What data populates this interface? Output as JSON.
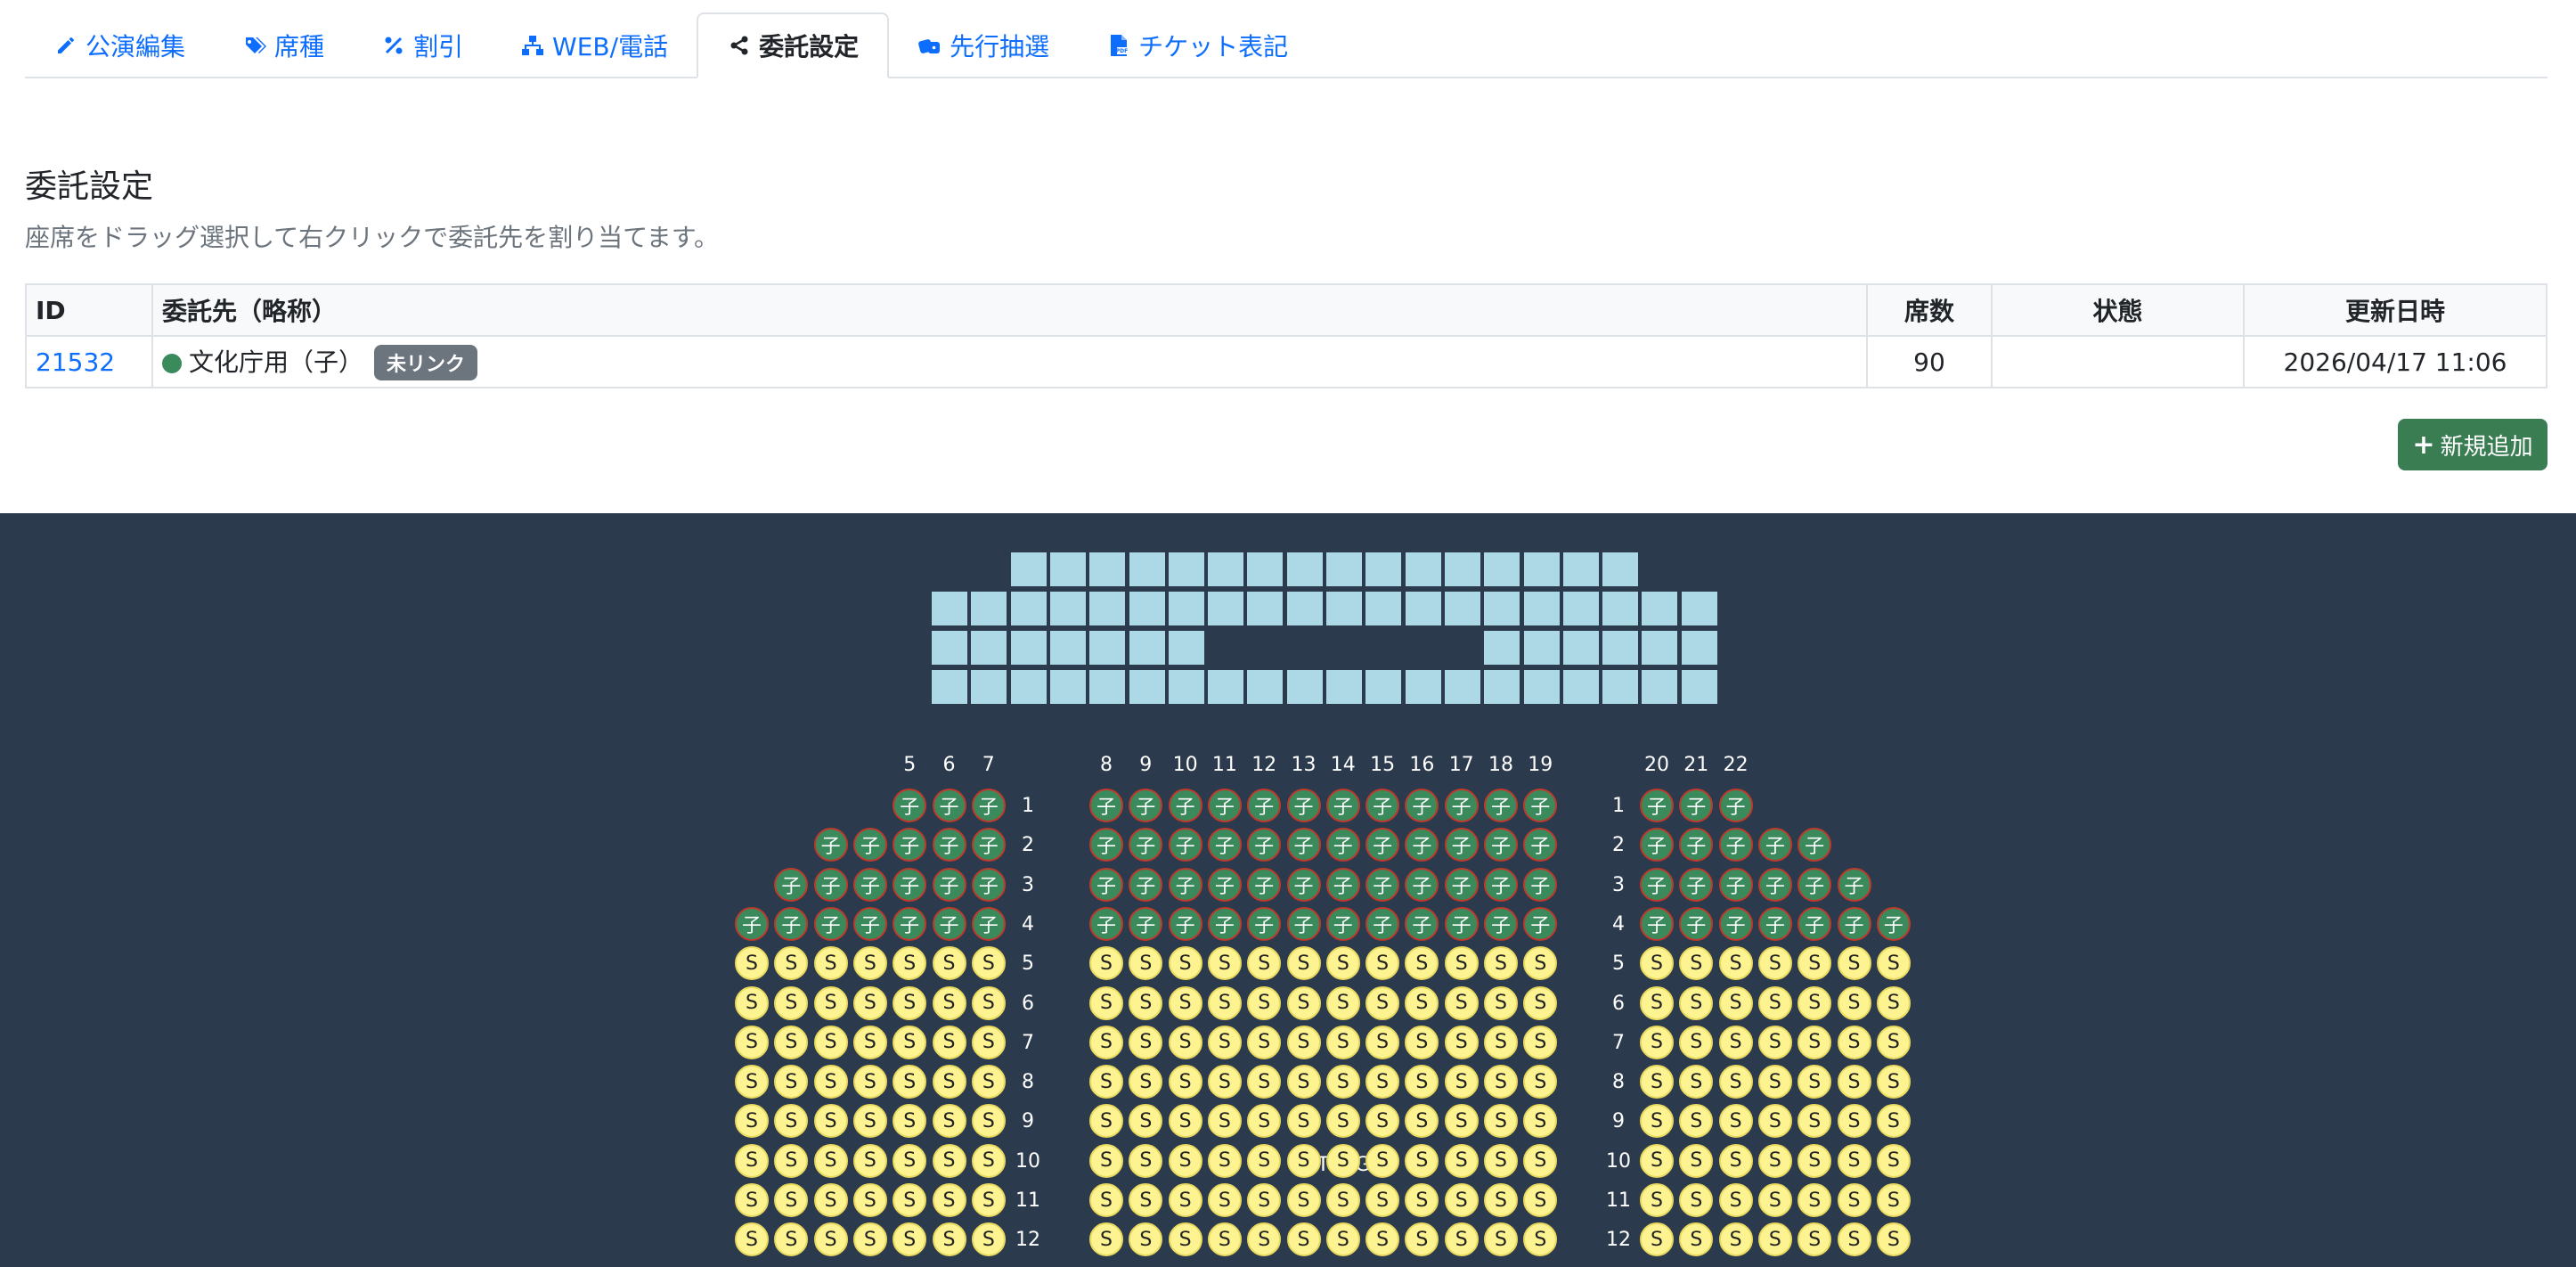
{
  "tabs": [
    {
      "label": "公演編集",
      "icon": "pencil-icon"
    },
    {
      "label": "席種",
      "icon": "tags-icon"
    },
    {
      "label": "割引",
      "icon": "percent-icon"
    },
    {
      "label": "WEB/電話",
      "icon": "sitemap-icon"
    },
    {
      "label": "委託設定",
      "icon": "share-icon",
      "active": true
    },
    {
      "label": "先行抽選",
      "icon": "dice-icon"
    },
    {
      "label": "チケット表記",
      "icon": "file-pdf-icon"
    }
  ],
  "page": {
    "title": "委託設定",
    "description": "座席をドラッグ選択して右クリックで委託先を割り当てます。"
  },
  "table": {
    "headers": {
      "id": "ID",
      "name": "委託先（略称）",
      "seats": "席数",
      "status": "状態",
      "updated": "更新日時"
    },
    "rows": [
      {
        "id": "21532",
        "name": "文化庁用（子）",
        "badge": "未リンク",
        "seats": "90",
        "status": "",
        "updated": "2026/04/17 11:06",
        "color": "#3a8a5c"
      }
    ]
  },
  "add_button": "新規追加",
  "seatmap": {
    "stage_label": "S T A G E",
    "colors": {
      "background": "#2c3a4d",
      "stage_block": "#add8e6",
      "consign_seat": "#3a8a5c",
      "s_seat": "#fdf391"
    },
    "seat_labels": {
      "consign": "子",
      "s": "S"
    },
    "column_numbers": {
      "left": [
        "5",
        "6",
        "7"
      ],
      "center": [
        "8",
        "9",
        "10",
        "11",
        "12",
        "13",
        "14",
        "15",
        "16",
        "17",
        "18",
        "19"
      ],
      "right": [
        "20",
        "21",
        "22"
      ]
    },
    "row_numbers": [
      "1",
      "2",
      "3",
      "4",
      "5",
      "6",
      "7",
      "8",
      "9",
      "10",
      "11",
      "12"
    ],
    "left_rows": [
      3,
      5,
      6,
      7,
      7,
      7,
      7,
      7,
      7,
      7,
      7,
      7
    ],
    "center_rows": [
      12,
      12,
      12,
      12,
      12,
      12,
      12,
      12,
      12,
      12,
      12,
      12
    ],
    "right_rows": [
      3,
      5,
      6,
      7,
      7,
      7,
      7,
      7,
      7,
      7,
      7,
      7
    ],
    "consign_rows": 4
  }
}
